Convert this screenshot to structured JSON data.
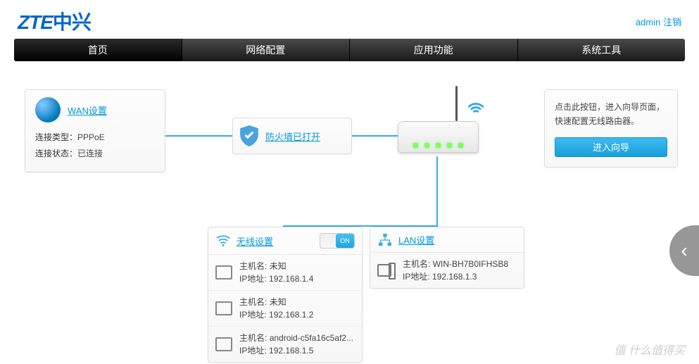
{
  "header": {
    "logo_en": "ZTE",
    "logo_cn": "中兴",
    "user": "admin",
    "logout": "注销"
  },
  "nav": {
    "tabs": [
      "首页",
      "网络配置",
      "应用功能",
      "系统工具"
    ],
    "active": 0
  },
  "wan": {
    "link": "WAN设置",
    "type_label": "连接类型：",
    "type_value": "PPPoE",
    "status_label": "连接状态：",
    "status_value": "已连接"
  },
  "firewall": {
    "link": "防火墙已打开"
  },
  "guide": {
    "text": "点击此按钮，进入向导页面，快速配置无线路由器。",
    "button": "进入向导"
  },
  "wifi": {
    "link": "无线设置",
    "toggle": "ON",
    "devices": [
      {
        "host_label": "主机名:",
        "host": "未知",
        "ip_label": "IP地址:",
        "ip": "192.168.1.4"
      },
      {
        "host_label": "主机名:",
        "host": "未知",
        "ip_label": "IP地址:",
        "ip": "192.168.1.2"
      },
      {
        "host_label": "主机名:",
        "host": "android-c5fa16c5af2...",
        "ip_label": "IP地址:",
        "ip": "192.168.1.5"
      }
    ]
  },
  "lan": {
    "link": "LAN设置",
    "devices": [
      {
        "host_label": "主机名:",
        "host": "WIN-BH7B0IFHSB8",
        "ip_label": "IP地址:",
        "ip": "192.168.1.3"
      }
    ]
  },
  "watermark": "什么值得买"
}
